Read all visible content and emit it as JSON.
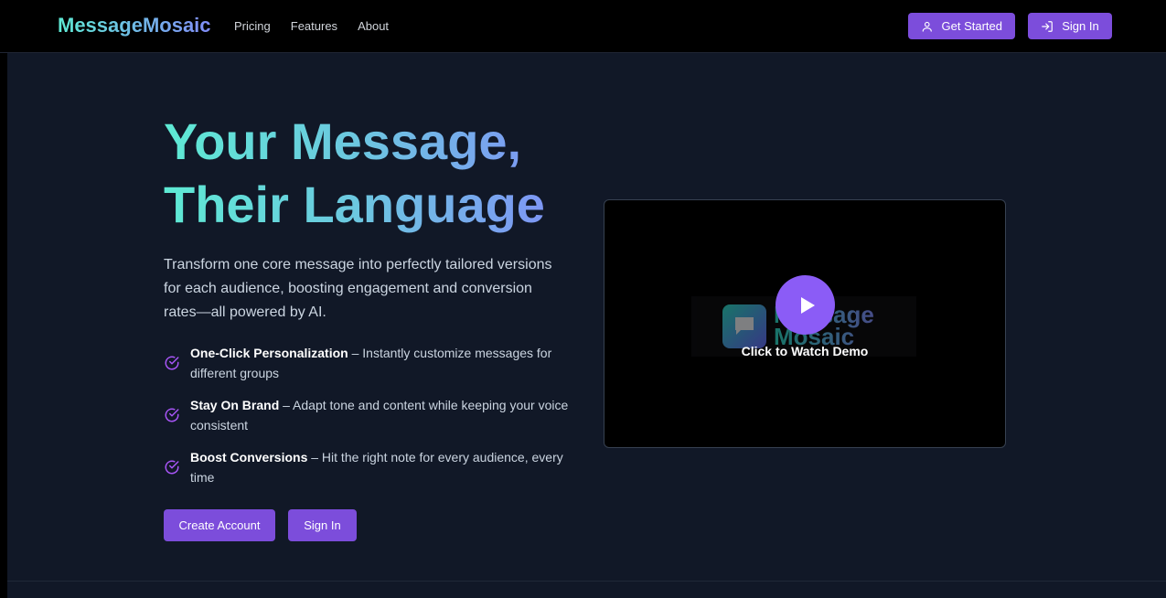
{
  "nav": {
    "brand": "MessageMosaic",
    "links": [
      "Pricing",
      "Features",
      "About"
    ],
    "get_started": "Get Started",
    "sign_in": "Sign In"
  },
  "hero": {
    "headline_line1": "Your Message,",
    "headline_line2": "Their Language",
    "subtitle": "Transform one core message into perfectly tailored versions for each audience, boosting engagement and conversion rates—all powered by AI.",
    "features": [
      {
        "title": "One-Click Personalization",
        "desc": " – Instantly customize messages for different groups"
      },
      {
        "title": "Stay On Brand",
        "desc": " – Adapt tone and content while keeping your voice consistent"
      },
      {
        "title": "Boost Conversions",
        "desc": " – Hit the right note for every audience, every time"
      }
    ],
    "create_account": "Create Account",
    "sign_in": "Sign In"
  },
  "video": {
    "logo_line1": "Message",
    "logo_line2": "Mosaic",
    "caption": "Click to Watch Demo"
  },
  "colors": {
    "accent": "#7c4ddb",
    "background": "#111827",
    "gradient_start": "#5eead4",
    "gradient_end": "#818cf8"
  }
}
